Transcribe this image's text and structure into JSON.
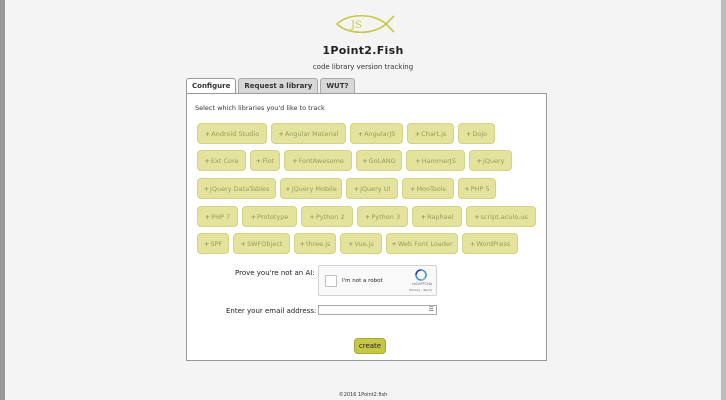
{
  "header": {
    "title": "1Point2.Fish",
    "tagline": "code library version tracking"
  },
  "tabs": [
    {
      "label": "Configure",
      "active": true
    },
    {
      "label": "Request a library",
      "active": false
    },
    {
      "label": "WUT?",
      "active": false
    }
  ],
  "instructions": "Select which libraries you'd like to track",
  "libraries": [
    [
      "Android Studio",
      "Angular Material",
      "AngularJS",
      "Chart.js",
      "Dojo"
    ],
    [
      "Ext Core",
      "Flot",
      "FontAwesome",
      "GoLANG",
      "HammerJS",
      "jQuery"
    ],
    [
      "jQuery DataTables",
      "jQuery Mobile",
      "jQuery UI",
      "MooTools",
      "PHP 5"
    ],
    [
      "PHP 7",
      "Prototype",
      "Python 2",
      "Python 3",
      "Raphael",
      "script.aculo.us"
    ],
    [
      "SPF",
      "SWFObject",
      "three.js",
      "Vue.js",
      "Web Font Loader",
      "WordPress"
    ]
  ],
  "captcha": {
    "label": "Prove you're not an AI:",
    "checkbox_text": "I'm not a robot",
    "brand": "reCAPTCHA",
    "links": "Privacy - Terms"
  },
  "email": {
    "label": "Enter your email address:",
    "value": ""
  },
  "create_label": "create",
  "footer": "©2016 1Point2.fish",
  "colors": {
    "accent": "#c6c649",
    "chip_bg": "#e3e39d",
    "chip_text": "#9c9c5e"
  }
}
